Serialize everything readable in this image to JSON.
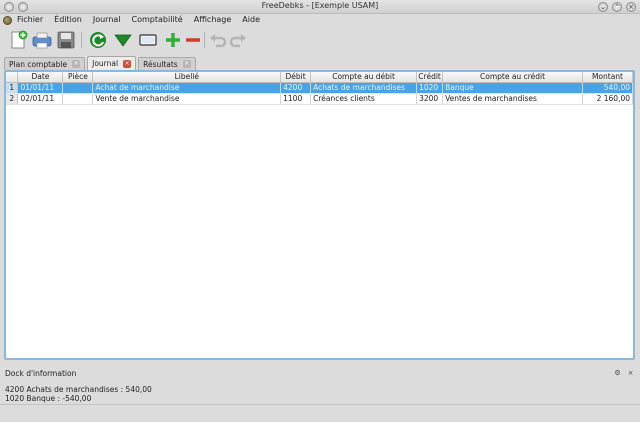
{
  "window": {
    "title": "FreeDebks - [Exemple USAM]"
  },
  "menu": [
    "Fichier",
    "Édition",
    "Journal",
    "Comptabilité",
    "Affichage",
    "Aide"
  ],
  "toolbar": {
    "tools": [
      "new-icon",
      "print-icon",
      "save-icon",
      "refresh-icon",
      "down-arrow-icon",
      "screen-icon",
      "add-icon",
      "remove-icon",
      "undo-icon",
      "redo-icon"
    ]
  },
  "tabs": [
    {
      "label": "Plan comptable",
      "active": false
    },
    {
      "label": "Journal",
      "active": true
    },
    {
      "label": "Résultats",
      "active": false
    }
  ],
  "table": {
    "columns": [
      "Date",
      "Pièce",
      "Libellé",
      "Débit",
      "Compte au débit",
      "Crédit",
      "Compte au crédit",
      "Montant"
    ],
    "rows": [
      {
        "num": "1",
        "date": "01/01/11",
        "piece": "",
        "libelle": "Achat de marchandise",
        "debit": "4200",
        "compte_debit": "Achats de marchandises",
        "credit": "1020",
        "compte_credit": "Banque",
        "montant": "540,00"
      },
      {
        "num": "2",
        "date": "02/01/11",
        "piece": "",
        "libelle": "Vente de marchandise",
        "debit": "1100",
        "compte_debit": "Créances clients",
        "credit": "3200",
        "compte_credit": "Ventes de marchandises",
        "montant": "2 160,00"
      }
    ]
  },
  "dock": {
    "title": "Dock d'information",
    "lines": [
      "4200 Achats de marchandises : 540,00",
      "1020 Banque : -540,00"
    ]
  },
  "colors": {
    "selection": "#4aa3e4",
    "frame": "#88b8dc",
    "add": "#2fae3a",
    "remove": "#d23a2a",
    "refresh": "#1d8a2a"
  }
}
